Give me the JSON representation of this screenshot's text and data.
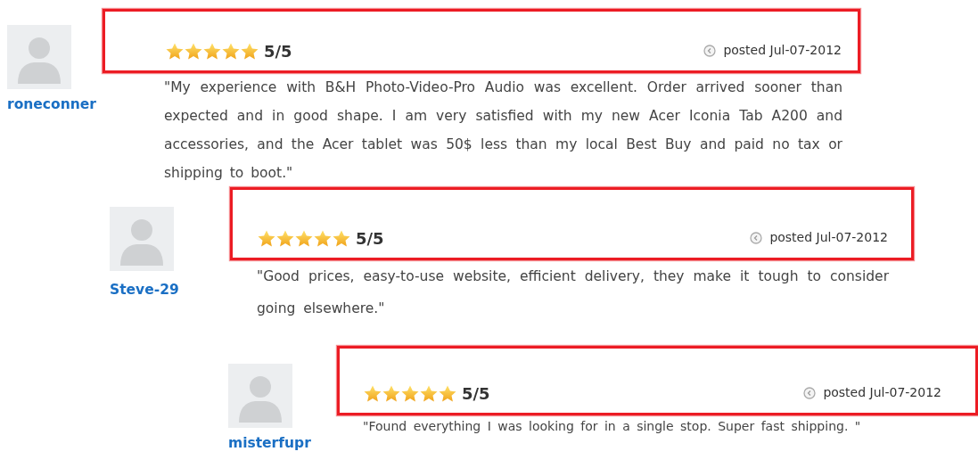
{
  "reviews": [
    {
      "username": "roneconner",
      "stars": 5,
      "score": "5/5",
      "posted": "posted Jul-07-2012",
      "text": "\"My experience with B&H Photo-Video-Pro Audio was excellent. Order arrived sooner than expected and in good shape. I am very satisfied with my new Acer Iconia Tab A200 and accessories, and the Acer tablet was 50$ less than my local Best Buy and paid no tax or shipping to boot.\""
    },
    {
      "username": "Steve-29",
      "stars": 5,
      "score": "5/5",
      "posted": "posted Jul-07-2012",
      "text": "\"Good prices, easy-to-use website, efficient delivery, they make it tough to consider going elsewhere.\""
    },
    {
      "username": "misterfupr",
      "stars": 5,
      "score": "5/5",
      "posted": "posted Jul-07-2012",
      "text": "\"Found everything I was looking for in a single stop. Super fast shipping. \""
    }
  ]
}
